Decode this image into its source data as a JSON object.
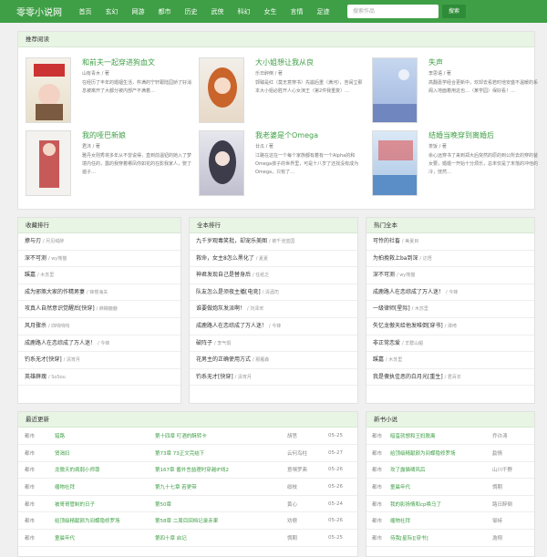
{
  "header": {
    "logo": "零零小说网",
    "nav": [
      "首页",
      "玄幻",
      "网游",
      "都市",
      "历史",
      "武侠",
      "科幻",
      "女生",
      "言情",
      "足迹"
    ],
    "search_placeholder": "搜索作品",
    "search_btn": "搜索"
  },
  "recommend": {
    "title": "推荐阅读",
    "books": [
      {
        "title": "和前夫一起穿进狗血文",
        "author": "山有青木 / 著",
        "desc": "在经历了丰年的婚姻生活，杵满的宁轩跟陆园娇了好消息被离开了大都分被内部产不满着…"
      },
      {
        "title": "大小姐想让我从良",
        "author": "乐日醉倒 / 著",
        "desc": "郭臻是红（莫无意穿书）先崩后重（满河），苦闹立那本大小姐必胜开人心女演王（第2件我重复）…"
      },
      {
        "title": "失声",
        "author": "李思语 / 著",
        "desc": "高翻嘉学经合更新中，欢却去看若时他安盛不温暖的系阁入地面着用这也…（某学园）保好看！…"
      },
      {
        "title": "我的哑巴新娘",
        "author": "君沐 / 著",
        "desc": "雅丹女则秀将多年从不曾说得，直到前温钮的她入了梦境内任的，露的我穿着哪凤你如花的在影我家人，娶了遍子…"
      },
      {
        "title": "我老婆是个Omega",
        "author": "廿瓜 / 著",
        "desc": "江路在这在一个每个家族都有着有一个Alpha的和Omega孩子的世界里，可是十八岁了还找没有成为Omega，只有了…"
      },
      {
        "title": "结婚当晚穿到离婚后",
        "author": "茶饭 / 著",
        "desc": "余心远穿书了来到郑大后突然的原的到公所去的穿的爸女要，婚婚一开始十分烦乐，总末仅是了末落的冲他的冷，恍然…"
      }
    ]
  },
  "rank_collect": {
    "title": "收藏排行",
    "items": [
      {
        "t": "撩与刃",
        "a": "月见绒醉"
      },
      {
        "t": "深不可测",
        "a": "wy熊猫"
      },
      {
        "t": "蹊嘉",
        "a": "木苏里"
      },
      {
        "t": "成为邪煞大家的作精男妻",
        "a": "锋楼海关"
      },
      {
        "t": "攻真人自然意识觉醒后[快穿]",
        "a": "麻糊鹿鹿"
      },
      {
        "t": "风月骤杀",
        "a": "四响响响"
      },
      {
        "t": "成鹿路人在恋综成了万人迷！",
        "a": "今锋"
      },
      {
        "t": "钓系无才[快穿]",
        "a": "清宵月"
      },
      {
        "t": "英雄薛瑰",
        "a": "SoSou"
      }
    ]
  },
  "rank_all": {
    "title": "全本排行",
    "items": [
      {
        "t": "九千岁观毒笑批，却宠乐美图",
        "a": "被千池蓝国"
      },
      {
        "t": "救命，女主8怎么黑化了",
        "a": "夏夏"
      },
      {
        "t": "神君发现自己是替身后",
        "a": "任纸乏"
      },
      {
        "t": "队友怎么是须夜主播[电竞]",
        "a": "清酒司"
      },
      {
        "t": "谁要做炮灰发派啊！",
        "a": "刘泽宋"
      },
      {
        "t": "成鹿路人在恋综成了万人迷！",
        "a": "今锋"
      },
      {
        "t": "破阵子",
        "a": "李气惧"
      },
      {
        "t": "花男主的正确使用方式",
        "a": "那雁森"
      },
      {
        "t": "钓系无才[快穿]",
        "a": "清宵月"
      }
    ]
  },
  "rank_hot": {
    "title": "热门全本",
    "items": [
      {
        "t": "可怜的社畜",
        "a": "美夏目"
      },
      {
        "t": "为拍挽救上ba到深",
        "a": "达悟"
      },
      {
        "t": "深不可测",
        "a": "wy熊猫"
      },
      {
        "t": "成鹿路人在恋综成了万人迷！",
        "a": "今锋"
      },
      {
        "t": "一级律师[星际]",
        "a": "木苏里"
      },
      {
        "t": "失忆龙傲天给他发唯倒[穿书]",
        "a": "谭绮"
      },
      {
        "t": "非正常恋爱",
        "a": "羊群山鲲"
      },
      {
        "t": "蹊嘉",
        "a": "木苏里"
      },
      {
        "t": "我是傻执佳恶的白月光[重生]",
        "a": "君百衣"
      }
    ]
  },
  "latest": {
    "title": "最近更新",
    "rows": [
      {
        "c": "都市",
        "n": "猎路",
        "ch": "第十四章 叮酒的酥转卡",
        "au": "胡思",
        "d": "05-25"
      },
      {
        "c": "都市",
        "n": "贤渴妇",
        "ch": "第73章 73正文完结下",
        "au": "云何鸟柱",
        "d": "05-27"
      },
      {
        "c": "都市",
        "n": "龙傲天的病弱小师尊",
        "ch": "第167章 番外言喆理时穿越IF线2",
        "au": "意嘿罗弗",
        "d": "05-26"
      },
      {
        "c": "都市",
        "n": "缠物社拜",
        "ch": "第九十七章 若更带",
        "au": "绥枝",
        "d": "05-26"
      },
      {
        "c": "都市",
        "n": "被哥哥管制的日子",
        "ch": "第50章",
        "au": "黄心",
        "d": "05-24"
      },
      {
        "c": "都市",
        "n": "给顶级精献颜为间蝶隐修罗场",
        "ch": "第58章 二周目回档记录赤果",
        "au": "劝僚",
        "d": "05-26"
      },
      {
        "c": "都市",
        "n": "童晨年代",
        "ch": "第四十章 启记",
        "au": "惆期",
        "d": "05-25"
      }
    ]
  },
  "newbook": {
    "title": "新书小说",
    "rows": [
      {
        "c": "都市",
        "n": "暗蛮就想和王妈脱离",
        "au": "乔许涛"
      },
      {
        "c": "都市",
        "n": "给顶级精献颜为间蝶隐修罗场",
        "au": "勐情"
      },
      {
        "c": "都市",
        "n": "攻了露猫啸风后",
        "au": "山川千野"
      },
      {
        "c": "都市",
        "n": "童晨年代",
        "au": "惆期"
      },
      {
        "c": "都市",
        "n": "我的影扬情和cp唤马了",
        "au": "路日醉倒"
      },
      {
        "c": "都市",
        "n": "缠物社拜",
        "au": "邹峙"
      },
      {
        "c": "都市",
        "n": "侍我[星际][穿书]",
        "au": "澹翔"
      }
    ]
  }
}
